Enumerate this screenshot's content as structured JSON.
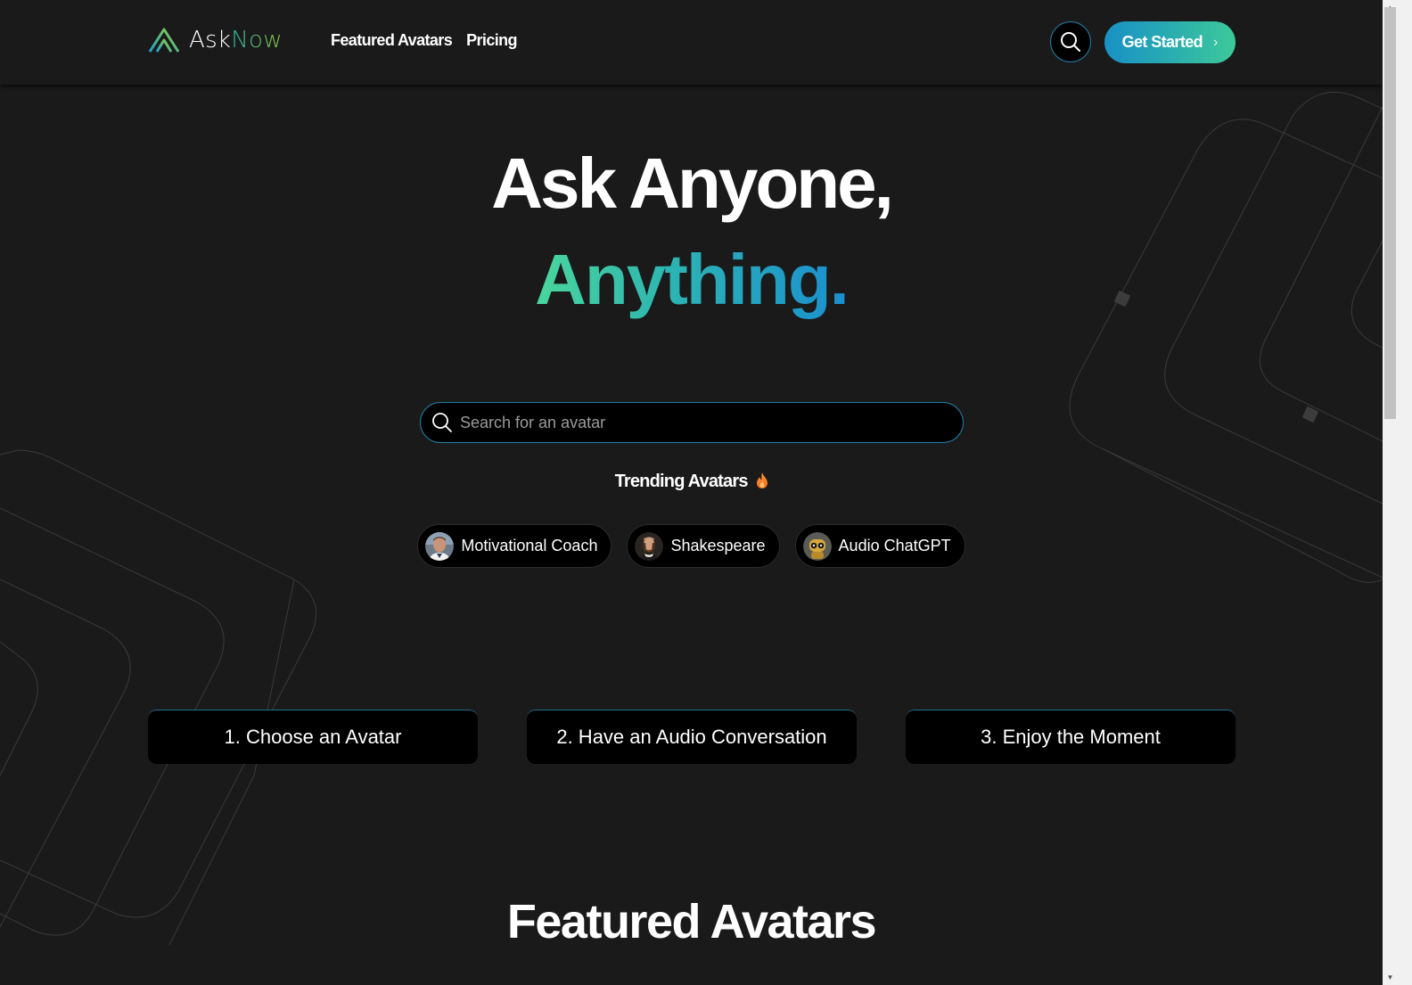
{
  "header": {
    "logo": {
      "part1": "Ask",
      "part2": "Now",
      "icon": "asknow-triangle-logo-icon"
    },
    "nav": [
      {
        "label": "Featured Avatars"
      },
      {
        "label": "Pricing"
      }
    ],
    "search_icon": "search-icon",
    "cta": {
      "label": "Get Started",
      "chevron": "›"
    }
  },
  "hero": {
    "line1": "Ask Anyone,",
    "line2": "Anything.",
    "gradient": [
      "#4ad69c",
      "#2cb3b3",
      "#1a8fd0"
    ]
  },
  "search": {
    "placeholder": "Search for an avatar",
    "value": ""
  },
  "trending": {
    "title": "Trending Avatars",
    "icon": "flame-icon",
    "chips": [
      {
        "label": "Motivational Coach",
        "avatar": "motivational-coach-avatar"
      },
      {
        "label": "Shakespeare",
        "avatar": "shakespeare-avatar"
      },
      {
        "label": "Audio ChatGPT",
        "avatar": "audio-chatgpt-avatar"
      }
    ]
  },
  "steps": [
    {
      "label": "1. Choose an Avatar"
    },
    {
      "label": "2. Have an Audio Conversation"
    },
    {
      "label": "3. Enjoy the Moment"
    }
  ],
  "featured": {
    "title": "Featured Avatars"
  },
  "colors": {
    "background": "#1a1a1a",
    "accent_blue": "#1890c6",
    "accent_green": "#3cc99a",
    "border_blue": "#1e7fa6"
  }
}
